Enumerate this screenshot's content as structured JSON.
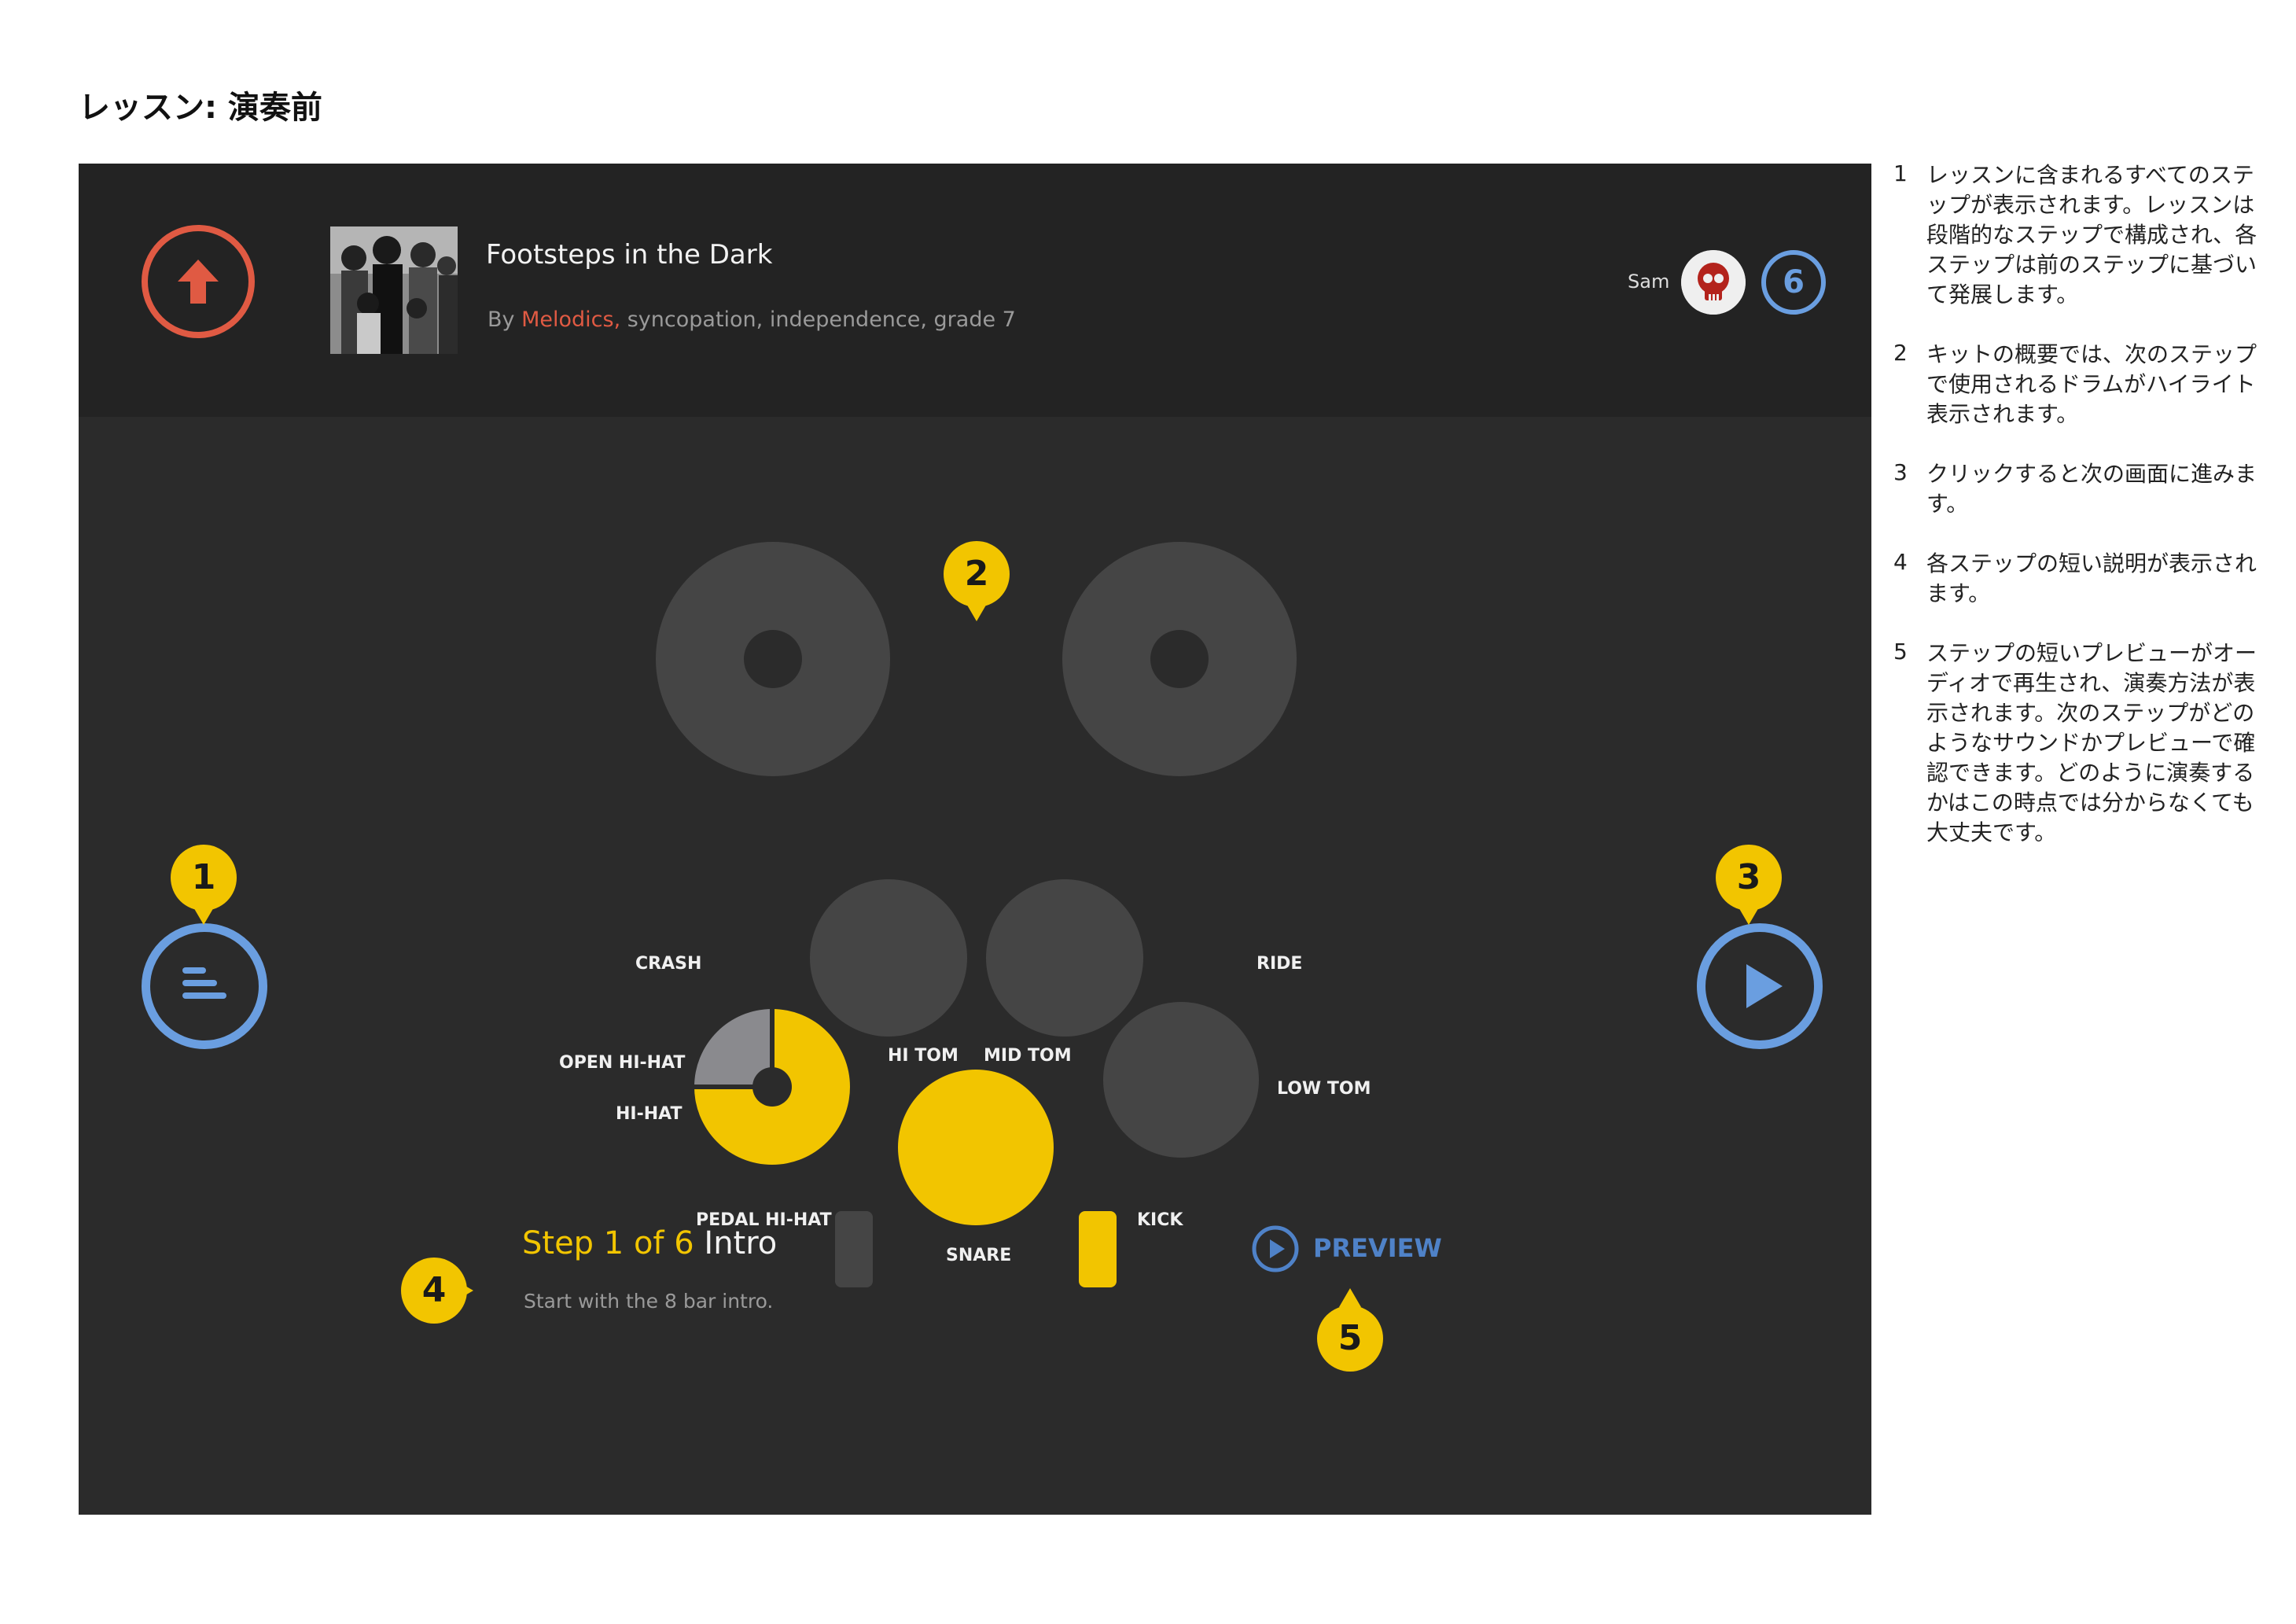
{
  "page": {
    "title": "レッスン: 演奏前"
  },
  "header": {
    "song_title": "Footsteps in the Dark",
    "by_prefix": "By ",
    "artist": "Melodics,",
    "tags": " syncopation, independence, grade 7",
    "user_name": "Sam",
    "level": "6"
  },
  "kit": {
    "labels": {
      "crash": "CRASH",
      "ride": "RIDE",
      "open_hihat": "OPEN HI-HAT",
      "hihat": "HI-HAT",
      "hi_tom": "HI TOM",
      "mid_tom": "MID TOM",
      "low_tom": "LOW TOM",
      "pedal_hihat": "PEDAL HI-HAT",
      "snare": "SNARE",
      "kick": "KICK"
    },
    "highlighted": [
      "hihat",
      "snare",
      "kick"
    ],
    "colors": {
      "highlight": "#f2c500",
      "inactive": "#454545",
      "open_hihat": "#8a8a8e"
    }
  },
  "step": {
    "count_label": "Step 1 of 6",
    "name": "Intro",
    "description": "Start with the 8 bar intro."
  },
  "preview": {
    "label": "PREVIEW"
  },
  "callouts": [
    "1",
    "2",
    "3",
    "4",
    "5"
  ],
  "notes": [
    {
      "num": "1",
      "text": "レッスンに含まれるすべてのステップが表示されます。レッスンは段階的なステップで構成され、各ステップは前のステップに基づいて発展します。"
    },
    {
      "num": "2",
      "text": "キットの概要では、次のステップで使用されるドラムがハイライト表示されます。"
    },
    {
      "num": "3",
      "text": "クリックすると次の画面に進みます。"
    },
    {
      "num": "4",
      "text": "各ステップの短い説明が表示されます。"
    },
    {
      "num": "5",
      "text": "ステップの短いプレビューがオーディオで再生され、演奏方法が表示されます。次のステップがどのようなサウンドかプレビューで確認できます。どのように演奏するかはこの時点では分からなくても大丈夫です。"
    }
  ],
  "icons": {
    "up": "up-arrow-icon",
    "steps": "steps-list-icon",
    "play": "play-icon",
    "preview": "play-circle-icon"
  },
  "colors": {
    "accent_blue": "#6a9ee0",
    "accent_red": "#e05a43",
    "callout_yellow": "#f2c500",
    "screen_bg": "#2b2b2b",
    "header_bg": "#232323"
  }
}
